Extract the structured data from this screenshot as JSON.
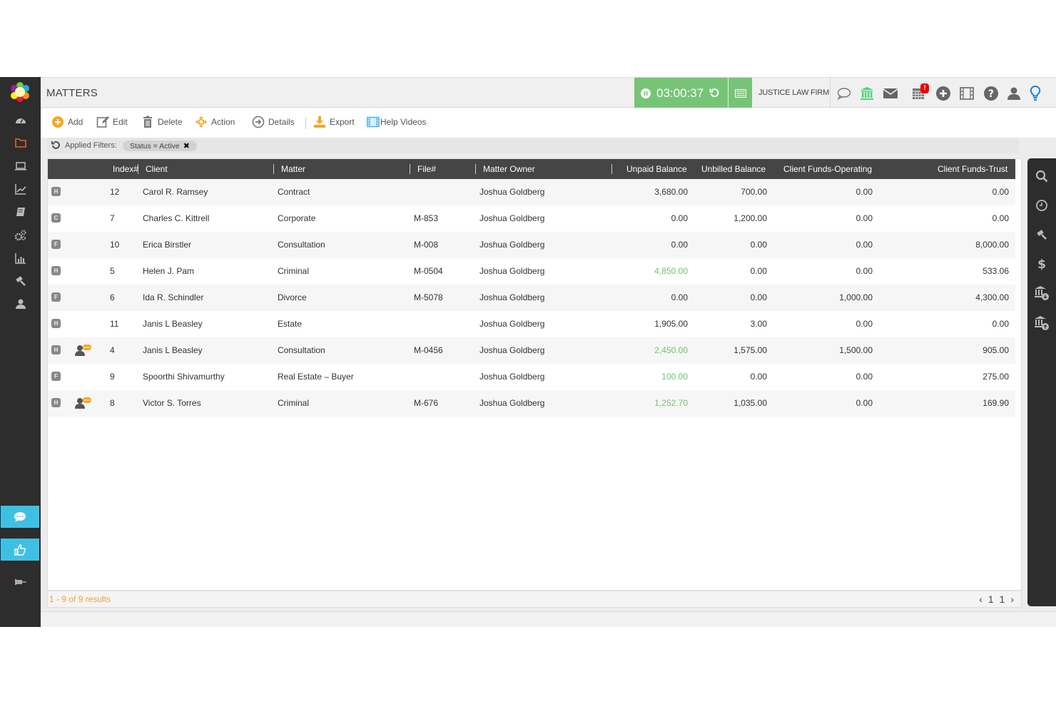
{
  "header": {
    "title": "MATTERS",
    "timer": "03:00:37",
    "firm_name": "JUSTICE LAW FIRM",
    "calendar_badge": "!"
  },
  "toolbar": {
    "add": "Add",
    "edit": "Edit",
    "delete": "Delete",
    "action": "Action",
    "details": "Details",
    "export": "Export",
    "help_videos": "Help Videos"
  },
  "filters": {
    "label": "Applied Filters:",
    "chips": [
      {
        "label": "Status = Active"
      }
    ]
  },
  "table": {
    "columns": [
      "Index#",
      "Client",
      "Matter",
      "File#",
      "Matter Owner",
      "Unpaid Balance",
      "Unbilled Balance",
      "Client Funds-Operating",
      "Client Funds-Trust"
    ],
    "rows": [
      {
        "type": "H",
        "portal": false,
        "index": "12",
        "client": "Carol R. Ramsey",
        "matter": "Contract",
        "file": "",
        "owner": "Joshua Goldberg",
        "unpaid": "3,680.00",
        "unpaid_green": false,
        "unbilled": "700.00",
        "operating": "0.00",
        "trust": "0.00"
      },
      {
        "type": "C",
        "portal": false,
        "index": "7",
        "client": "Charles C. Kittrell",
        "matter": "Corporate",
        "file": "M-853",
        "owner": "Joshua Goldberg",
        "unpaid": "0.00",
        "unpaid_green": false,
        "unbilled": "1,200.00",
        "operating": "0.00",
        "trust": "0.00"
      },
      {
        "type": "F",
        "portal": false,
        "index": "10",
        "client": "Erica Birstler",
        "matter": "Consultation",
        "file": "M-008",
        "owner": "Joshua Goldberg",
        "unpaid": "0.00",
        "unpaid_green": false,
        "unbilled": "0.00",
        "operating": "0.00",
        "trust": "8,000.00"
      },
      {
        "type": "H",
        "portal": false,
        "index": "5",
        "client": "Helen J. Pam",
        "matter": "Criminal",
        "file": "M-0504",
        "owner": "Joshua Goldberg",
        "unpaid": "4,850.00",
        "unpaid_green": true,
        "unbilled": "0.00",
        "operating": "0.00",
        "trust": "533.06"
      },
      {
        "type": "F",
        "portal": false,
        "index": "6",
        "client": "Ida R. Schindler",
        "matter": "Divorce",
        "file": "M-5078",
        "owner": "Joshua Goldberg",
        "unpaid": "0.00",
        "unpaid_green": false,
        "unbilled": "0.00",
        "operating": "1,000.00",
        "trust": "4,300.00"
      },
      {
        "type": "H",
        "portal": false,
        "index": "11",
        "client": "Janis L Beasley",
        "matter": "Estate",
        "file": "",
        "owner": "Joshua Goldberg",
        "unpaid": "1,905.00",
        "unpaid_green": false,
        "unbilled": "3.00",
        "operating": "0.00",
        "trust": "0.00"
      },
      {
        "type": "H",
        "portal": true,
        "index": "4",
        "client": "Janis L Beasley",
        "matter": "Consultation",
        "file": "M-0456",
        "owner": "Joshua Goldberg",
        "unpaid": "2,450.00",
        "unpaid_green": true,
        "unbilled": "1,575.00",
        "operating": "1,500.00",
        "trust": "905.00"
      },
      {
        "type": "F",
        "portal": false,
        "index": "9",
        "client": "Spoorthi Shivamurthy",
        "matter": "Real Estate – Buyer",
        "file": "",
        "owner": "Joshua Goldberg",
        "unpaid": "100.00",
        "unpaid_green": true,
        "unbilled": "0.00",
        "operating": "0.00",
        "trust": "275.00"
      },
      {
        "type": "H",
        "portal": true,
        "index": "8",
        "client": "Victor S. Torres",
        "matter": "Criminal",
        "file": "M-676",
        "owner": "Joshua Goldberg",
        "unpaid": "1,252.70",
        "unpaid_green": true,
        "unbilled": "1,035.00",
        "operating": "0.00",
        "trust": "169.90"
      }
    ]
  },
  "footer": {
    "results": "1 - 9 of 9 results",
    "page_current": "1",
    "page_total": "1"
  },
  "colors": {
    "accent_green": "#76c476",
    "sidebar_active": "#e0642c",
    "cyan": "#3fc0e3",
    "orange": "#f5a623"
  }
}
